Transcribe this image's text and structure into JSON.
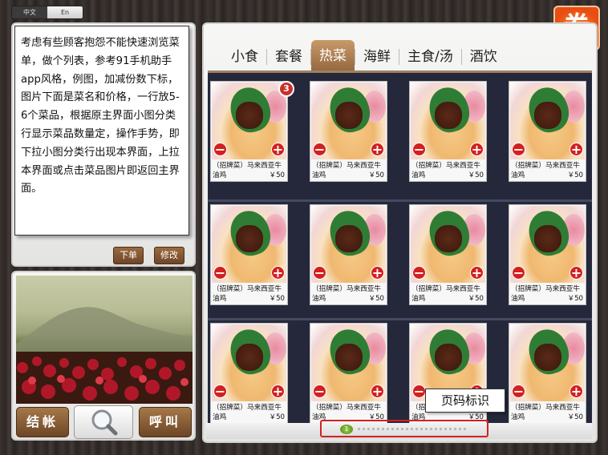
{
  "language": {
    "zh": "中文",
    "en": "En"
  },
  "coupon": {
    "label": "券"
  },
  "note": {
    "text": "考虑有些顾客抱怨不能快速浏览菜单，做个列表，参考91手机助手app风格，例图，加减份数下标，图片下面是菜名和价格，一行放5-6个菜品，根据原主界面小图分类行显示菜品数量定，操作手势，即下拉小图分类行出现本界面，上拉本界面或点击菜品图片即返回主界面。"
  },
  "order_panel": {
    "order_label": "下单",
    "edit_label": "修改"
  },
  "bottom_buttons": {
    "checkout": "结帐",
    "call": "呼叫"
  },
  "tabs": [
    {
      "label": "小食",
      "active": false
    },
    {
      "label": "套餐",
      "active": false
    },
    {
      "label": "热菜",
      "active": true
    },
    {
      "label": "海鲜",
      "active": false
    },
    {
      "label": "主食/汤",
      "active": false
    },
    {
      "label": "酒饮",
      "active": false
    }
  ],
  "dishes": [
    {
      "name": "（招牌菜）马来西亚牛油鸡",
      "price": "￥50",
      "count": "3"
    },
    {
      "name": "（招牌菜）马来西亚牛油鸡",
      "price": "￥50",
      "count": ""
    },
    {
      "name": "（招牌菜）马来西亚牛油鸡",
      "price": "￥50",
      "count": ""
    },
    {
      "name": "（招牌菜）马来西亚牛油鸡",
      "price": "￥50",
      "count": ""
    },
    {
      "name": "（招牌菜）马来西亚牛油鸡",
      "price": "￥50",
      "count": ""
    },
    {
      "name": "（招牌菜）马来西亚牛油鸡",
      "price": "￥50",
      "count": ""
    },
    {
      "name": "（招牌菜）马来西亚牛油鸡",
      "price": "￥50",
      "count": ""
    },
    {
      "name": "（招牌菜）马来西亚牛油鸡",
      "price": "￥50",
      "count": ""
    },
    {
      "name": "（招牌菜）马来西亚牛油鸡",
      "price": "￥50",
      "count": ""
    },
    {
      "name": "（招牌菜）马来西亚牛油鸡",
      "price": "￥50",
      "count": ""
    },
    {
      "name": "（招牌菜）马来西亚牛油鸡",
      "price": "￥50",
      "count": ""
    },
    {
      "name": "（招牌菜）马来西亚牛油鸡",
      "price": "￥50",
      "count": ""
    }
  ],
  "pager": {
    "current": "1",
    "callout": "页码标识"
  },
  "colors": {
    "accent": "#96693f",
    "badge": "#c9302c",
    "coupon": "#e84d12",
    "pager_highlight": "#d32121"
  }
}
